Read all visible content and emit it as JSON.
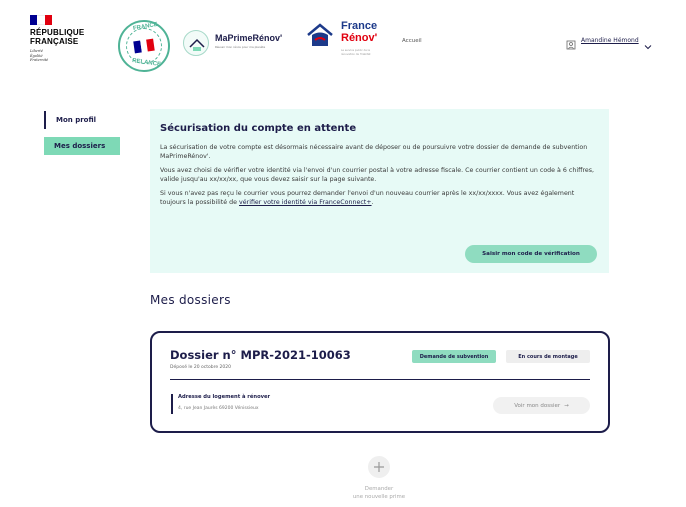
{
  "header": {
    "republic": {
      "line1": "RÉPUBLIQUE",
      "line2": "FRANÇAISE",
      "motto": [
        "Liberté",
        "Égalité",
        "Fraternité"
      ]
    },
    "badge": {
      "top": "FRANCE",
      "bottom": "RELANCE"
    },
    "maprimerenov": {
      "name": "MaPrimeRénov'",
      "subtitle": "Réussir mon rénov pour ma planète"
    },
    "france_renov": {
      "line1": "France",
      "line2": "Rénov'",
      "subtitle": "Le service public de la rénovation de l'habitat"
    },
    "nav_home": "Accueil",
    "user_name": "Amandine Hémond"
  },
  "sidebar": {
    "items": [
      {
        "label": "Mon profil"
      },
      {
        "label": "Mes dossiers"
      }
    ]
  },
  "alert": {
    "title": "Sécurisation du compte en attente",
    "p1": "La sécurisation de votre compte est désormais nécessaire avant de déposer ou de poursuivre votre dossier de demande de subvention MaPrimeRénov'.",
    "p2": "Vous avez choisi de vérifier votre identité via l'envoi d'un courrier postal à votre adresse fiscale. Ce courrier contient un code à 6 chiffres, valide jusqu'au xx/xx/xx, que vous devez saisir sur la page suivante.",
    "p3_prefix": "Si vous n'avez pas reçu le courrier vous pourrez demander l'envoi d'un nouveau courrier après le xx/xx/xxxx. Vous avez également toujours la possibilité de ",
    "p3_link": "vérifier votre identité via FranceConnect+",
    "p3_suffix": ".",
    "button": "Saisir mon code de vérification"
  },
  "section_title": "Mes dossiers",
  "dossier": {
    "title": "Dossier n° MPR-2021-10063",
    "date": "Déposé le 20 octobre 2020",
    "tags": [
      "Demande de subvention",
      "En cours de montage"
    ],
    "address_label": "Adresse du logement à rénover",
    "address_value": "4, rue Jean Jaurès 69200 Vénissieux",
    "button": "Voir mon dossier",
    "button_arrow": "→"
  },
  "new_demand": {
    "plus": "+",
    "line1": "Demander",
    "line2": "une nouvelle prime"
  },
  "colors": {
    "navy": "#1d1d4a",
    "mint": "#7ed9b6",
    "mint_light": "#e7faf6",
    "flag_blue": "#000091",
    "flag_red": "#e1000f"
  }
}
